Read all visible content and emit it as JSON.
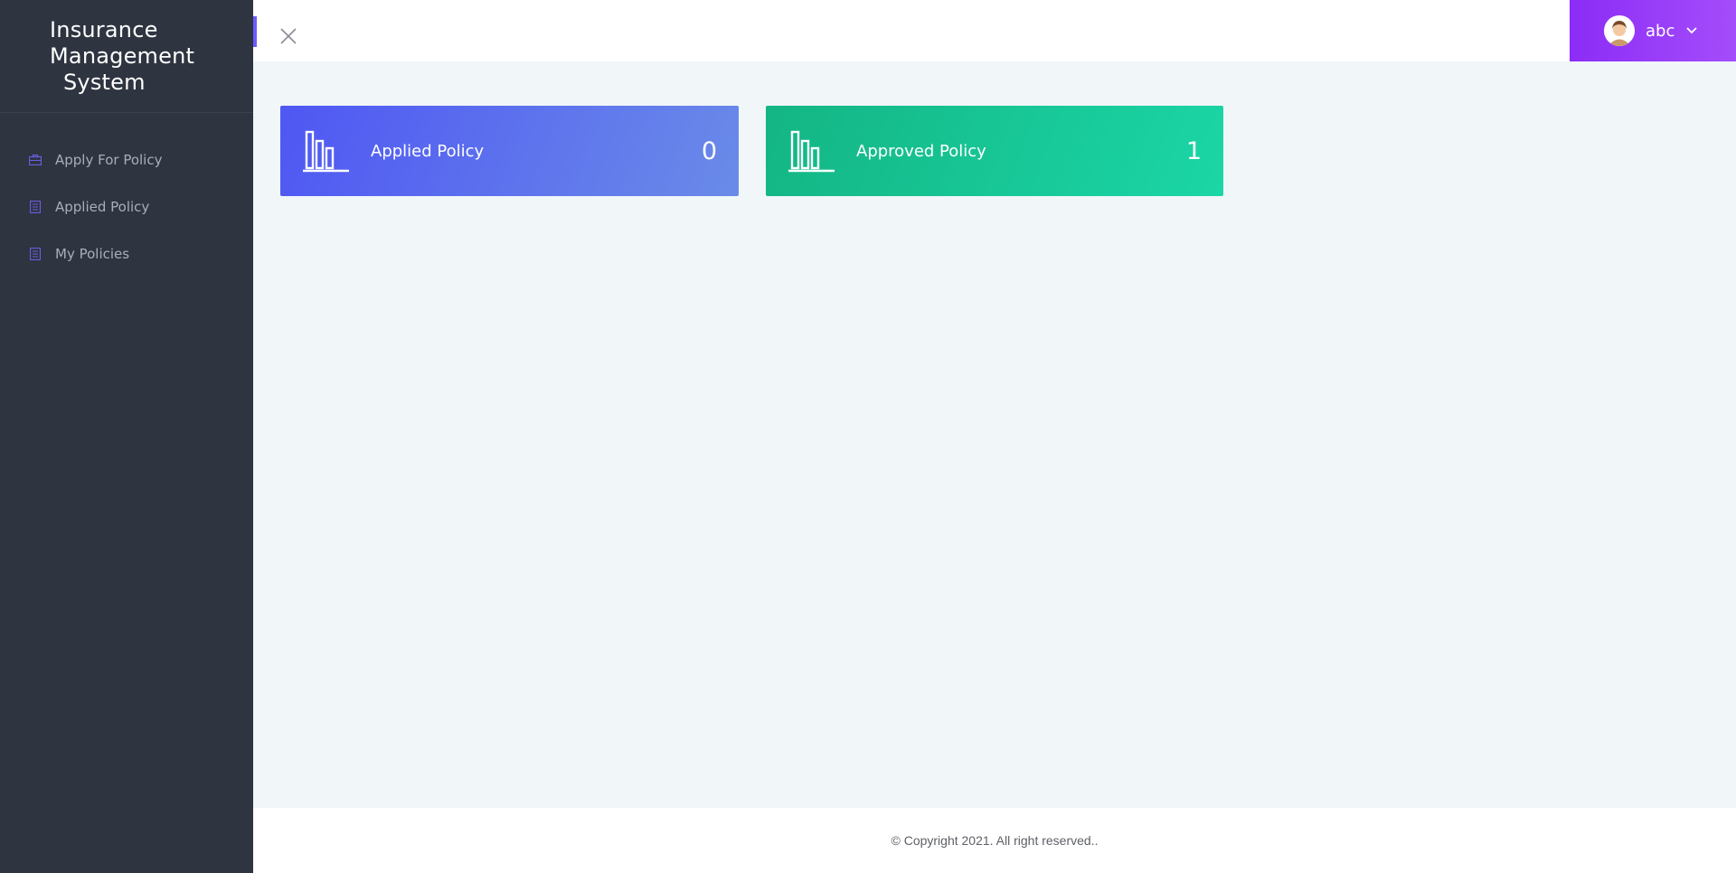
{
  "sidebar": {
    "brand": {
      "line1": "Insurance",
      "line2": "Management",
      "line3": "System"
    },
    "items": [
      {
        "label": "Apply For Policy",
        "icon": "briefcase-icon"
      },
      {
        "label": "Applied Policy",
        "icon": "document-icon"
      },
      {
        "label": "My Policies",
        "icon": "document-icon"
      }
    ]
  },
  "header": {
    "close_icon": "close-icon",
    "user": {
      "name": "abc",
      "avatar": "avatar-icon",
      "caret": "chevron-down-icon"
    }
  },
  "cards": [
    {
      "title": "Applied Policy",
      "value": "0",
      "icon": "bar-chart-icon"
    },
    {
      "title": "Approved Policy",
      "value": "1",
      "icon": "bar-chart-icon"
    }
  ],
  "footer": {
    "text": "© Copyright 2021. All right reserved.."
  },
  "colors": {
    "sidebar_bg": "#2e3440",
    "accent": "#6a5cff",
    "user_menu": "#9a3cf8",
    "card_blue": "#5563f0",
    "card_green": "#17c494"
  }
}
